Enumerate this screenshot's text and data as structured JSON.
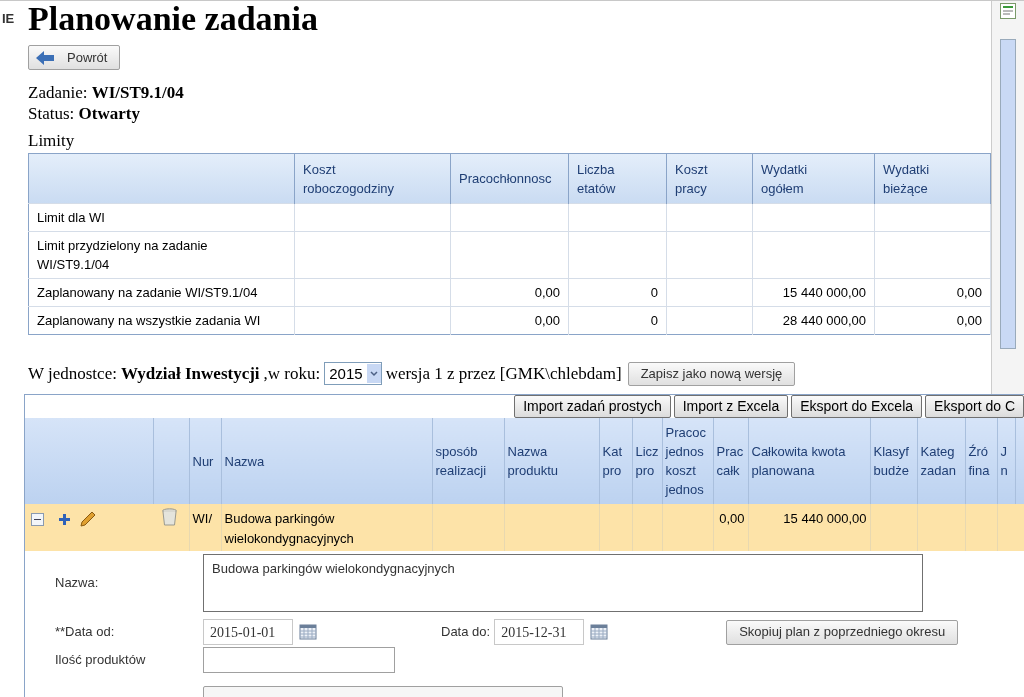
{
  "header_fragment": "IE",
  "title": "Planowanie zadania",
  "back_button": "Powrót",
  "task": {
    "label": "Zadanie:",
    "value": "WI/ST9.1/04"
  },
  "status": {
    "label": "Status:",
    "value": "Otwarty"
  },
  "limits": {
    "title": "Limity",
    "columns": [
      "Koszt roboczogodziny",
      "Pracochłonnosc",
      "Liczba etatów",
      "Koszt pracy",
      "Wydatki ogółem",
      "Wydatki bieżące"
    ],
    "rows": [
      {
        "label": "Limit dla WI",
        "cells": [
          null,
          null,
          null,
          null,
          null,
          null
        ]
      },
      {
        "label": "Limit przydzielony na zadanie WI/ST9.1/04",
        "cells": [
          null,
          null,
          null,
          null,
          null,
          null
        ]
      },
      {
        "label": "Zaplanowany na zadanie WI/ST9.1/04",
        "cells": [
          null,
          "0,00",
          "0",
          null,
          "15 440 000,00",
          "0,00"
        ]
      },
      {
        "label": "Zaplanowany na wszystkie zadania WI",
        "cells": [
          null,
          "0,00",
          "0",
          null,
          "28 440 000,00",
          "0,00"
        ]
      }
    ]
  },
  "unit_line": {
    "prefix": "W jednostce:",
    "unit": "Wydział Inwestycji",
    "year_label": ",w roku:",
    "year": "2015",
    "version": "wersja 1 z przez [GMK\\chlebdam]",
    "save_button": "Zapisz jako nową wersję"
  },
  "toolbar": [
    "Import zadań prostych",
    "Import z Excela",
    "Eksport do Excela",
    "Eksport do C"
  ],
  "grid": {
    "columns": [
      "Nur",
      "Nazwa",
      "sposób realizacji",
      "Nazwa produktu",
      "Kat pro",
      "Licz pro",
      "Pracoc jednos koszt jednos",
      "Prac całk",
      "Całkowita kwota planowana",
      "Klasyf budże",
      "Kateg zadan",
      "Źró fina",
      "J n"
    ],
    "rows": [
      {
        "expanded": true,
        "selected": true,
        "cells": [
          "WI/",
          "Budowa parkingów wielokondygnacyjnych",
          null,
          null,
          null,
          null,
          null,
          "0,00",
          "15 440 000,00",
          null,
          null,
          null,
          null
        ]
      }
    ]
  },
  "detail": {
    "name_label": "Nazwa:",
    "name_value": "Budowa parkingów wielokondygnacyjnych",
    "date_from_label": "**Data od:",
    "date_from": "2015-01-01",
    "date_to_label": "Data do:",
    "date_to": "2015-12-31",
    "copy_button": "Skopiuj plan z poprzedniego okresu",
    "products_label": "Ilość produktów"
  }
}
